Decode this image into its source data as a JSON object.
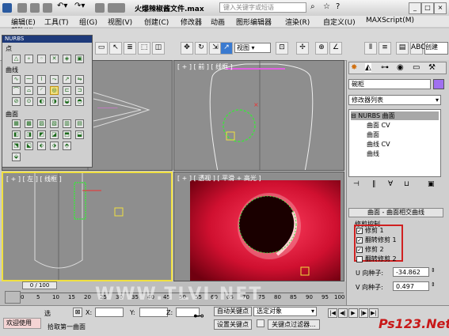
{
  "title": "火爆辣椒酱文件.max",
  "search_placeholder": "键入关键字或短语",
  "menu": [
    "编辑(E)",
    "工具(T)",
    "组(G)",
    "视图(V)",
    "创建(C)",
    "修改器",
    "动画",
    "图形编辑器",
    "渲染(R)",
    "自定义(U)",
    "MAXScript(M)"
  ],
  "menu_second_row": "帮助(H)",
  "toolbar": {
    "view_select": "视图"
  },
  "nurbs": {
    "title": "NURBS",
    "section_points": "点",
    "section_curves": "曲线",
    "section_surfaces": "曲面"
  },
  "viewports": {
    "top_right_label": "[ + ] [ 前 ] [ 线框 ]",
    "front_label_tag": "[ 顶 ]",
    "left_label": "[ + ] [ 左 ] [ 线框 ]",
    "persp_label": "[ + ] [ 透视 ] [ 平滑 + 高光 ]"
  },
  "rpanel": {
    "object_name": "碗柜",
    "modifier_list": "修改器列表",
    "stack": [
      "NURBS 曲面",
      "曲面 CV",
      "曲面",
      "曲线 CV",
      "曲线"
    ],
    "rollout_title": "曲面 - 曲面相交曲线",
    "trim_group": "修剪控制",
    "options": [
      {
        "label": "修剪 1",
        "checked": true
      },
      {
        "label": "翻转修剪 1",
        "checked": true
      },
      {
        "label": "修剪 2",
        "checked": true
      },
      {
        "label": "翻转修剪 2",
        "checked": false
      }
    ],
    "u_seed_label": "U 向种子:",
    "u_seed_value": "-34.862",
    "v_seed_label": "V 向种子:",
    "v_seed_value": "0.497"
  },
  "timeline": {
    "frame": "0 / 100",
    "ticks": [
      "0",
      "5",
      "10",
      "15",
      "20",
      "25",
      "30",
      "35",
      "40",
      "45",
      "50",
      "55",
      "60",
      "65",
      "70",
      "75",
      "80",
      "85",
      "90",
      "95",
      "100"
    ],
    "watermark": "WWW.TLVI.NET"
  },
  "status": {
    "welcome": "欢迎使用",
    "select_label": "选",
    "prompt": "拾取第一曲面",
    "x_label": "X:",
    "y_label": "Y:",
    "z_label": "Z:",
    "auto_key": "自动关键点",
    "set_key": "设置关键点",
    "selected_object": "选定对象",
    "key_filter": "关键点过滤器...",
    "brand": "Ps123.Net"
  },
  "colors": {
    "viewport_bg": "#8e8e8e",
    "active_border": "#f0e040",
    "persp_red": "#d01030",
    "selection_green": "#40e040",
    "highlight_red": "#d02020"
  }
}
